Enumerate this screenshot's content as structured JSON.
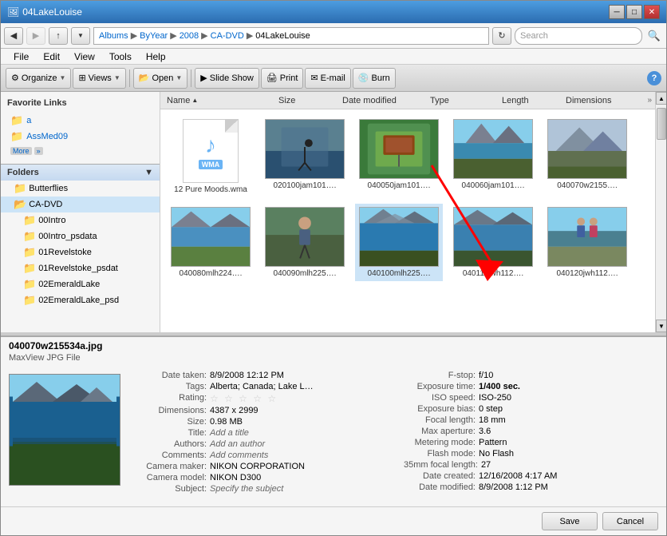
{
  "window": {
    "title": "04LakeLouise",
    "controls": [
      "minimize",
      "maximize",
      "close"
    ]
  },
  "address_bar": {
    "path": [
      "Albums",
      "ByYear",
      "2008",
      "CA-DVD",
      "04LakeLouise"
    ],
    "search_placeholder": "Search"
  },
  "menu": {
    "items": [
      "File",
      "Edit",
      "View",
      "Tools",
      "Help"
    ]
  },
  "toolbar": {
    "organize": "Organize",
    "views": "Views",
    "open": "Open",
    "slideshow": "Slide Show",
    "print": "Print",
    "email": "E-mail",
    "burn": "Burn"
  },
  "left_panel": {
    "favorite_links_title": "Favorite Links",
    "favorites": [
      {
        "label": "a"
      },
      {
        "label": "AssMed09"
      }
    ],
    "more_label": "More",
    "folders_title": "Folders",
    "folder_items": [
      {
        "label": "Butterflies",
        "indent": 1
      },
      {
        "label": "CA-DVD",
        "indent": 1
      },
      {
        "label": "00Intro",
        "indent": 2
      },
      {
        "label": "00Intro_psdata",
        "indent": 2
      },
      {
        "label": "01Revelstoke",
        "indent": 2
      },
      {
        "label": "01Revelstoke_psdat",
        "indent": 2
      },
      {
        "label": "02EmeraldLake",
        "indent": 2
      },
      {
        "label": "02EmeraldLake_psd",
        "indent": 2
      }
    ]
  },
  "columns": {
    "name": "Name",
    "size": "Size",
    "date_modified": "Date modified",
    "type": "Type",
    "length": "Length",
    "dimensions": "Dimensions"
  },
  "files": [
    {
      "id": "wma",
      "label": "12 Pure\nMoods.wma",
      "type": "wma"
    },
    {
      "id": "f1",
      "label": "020100jam101….",
      "type": "bike"
    },
    {
      "id": "f2",
      "label": "040050jam101….",
      "type": "sign"
    },
    {
      "id": "f3",
      "label": "040060jam101….",
      "type": "mtn-lake"
    },
    {
      "id": "f4",
      "label": "040070w2155….",
      "type": "grey-mtn"
    },
    {
      "id": "f5",
      "label": "040080mlh224….",
      "type": "river"
    },
    {
      "id": "f6",
      "label": "040090mlh225….",
      "type": "hiker"
    },
    {
      "id": "f7",
      "label": "040100mlh225….",
      "type": "lake2",
      "selected": true
    },
    {
      "id": "f8",
      "label": "040110jwh112….",
      "type": "lake2"
    },
    {
      "id": "f9",
      "label": "040120jwh112….",
      "type": "couple"
    }
  ],
  "bottom_info": {
    "filename": "040070w215534a.jpg",
    "filetype": "MaxView JPG File",
    "left_col": [
      {
        "label": "Date taken:",
        "value": "8/9/2008 12:12 PM",
        "bold": false
      },
      {
        "label": "Tags:",
        "value": "Alberta; Canada; Lake L…",
        "bold": false
      },
      {
        "label": "Rating:",
        "value": "stars",
        "bold": false
      },
      {
        "label": "Dimensions:",
        "value": "4387 x 2999",
        "bold": false
      },
      {
        "label": "Size:",
        "value": "0.98 MB",
        "bold": false
      },
      {
        "label": "Title:",
        "value": "Add a title",
        "italic": true
      },
      {
        "label": "Authors:",
        "value": "Add an author",
        "italic": true
      },
      {
        "label": "Comments:",
        "value": "Add comments",
        "italic": true
      },
      {
        "label": "Camera maker:",
        "value": "NIKON CORPORATION",
        "bold": false
      },
      {
        "label": "Camera model:",
        "value": "NIKON D300",
        "bold": false
      },
      {
        "label": "Subject:",
        "value": "Specify the subject",
        "italic": true
      }
    ],
    "right_col": [
      {
        "label": "F-stop:",
        "value": "f/10",
        "bold": false
      },
      {
        "label": "Exposure time:",
        "value": "1/400 sec.",
        "bold": true
      },
      {
        "label": "ISO speed:",
        "value": "ISO-250",
        "bold": false
      },
      {
        "label": "Exposure bias:",
        "value": "0 step",
        "bold": false
      },
      {
        "label": "Focal length:",
        "value": "18 mm",
        "bold": false
      },
      {
        "label": "Max aperture:",
        "value": "3.6",
        "bold": false
      },
      {
        "label": "Metering mode:",
        "value": "Pattern",
        "bold": false
      },
      {
        "label": "Flash mode:",
        "value": "No Flash",
        "bold": false
      },
      {
        "label": "35mm focal length:",
        "value": "27",
        "bold": false
      },
      {
        "label": "Date created:",
        "value": "12/16/2008 4:17 AM",
        "bold": false
      },
      {
        "label": "Date modified:",
        "value": "8/9/2008 1:12 PM",
        "bold": false
      }
    ]
  },
  "buttons": {
    "save": "Save",
    "cancel": "Cancel"
  }
}
